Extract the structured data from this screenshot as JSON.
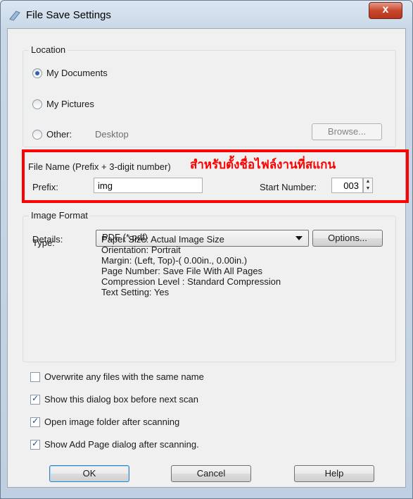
{
  "window": {
    "title": "File Save Settings",
    "close_label": "x"
  },
  "location": {
    "label": "Location",
    "options": [
      {
        "label": "My Documents",
        "checked": true
      },
      {
        "label": "My Pictures",
        "checked": false
      },
      {
        "label": "Other:",
        "checked": false
      }
    ],
    "other_path": "Desktop",
    "browse_label": "Browse..."
  },
  "file_name": {
    "label": "File Name (Prefix + 3-digit number)",
    "annotation": "สำหรับตั้งชื่อไฟล์งานที่สแกน",
    "prefix_label": "Prefix:",
    "prefix_value": "img",
    "start_label": "Start Number:",
    "start_value": "003"
  },
  "image_format": {
    "label": "Image Format",
    "type_label": "Type:",
    "type_value": "PDF (*.pdf)",
    "options_label": "Options...",
    "details_label": "Details:",
    "details": [
      "Paper Size: Actual Image Size",
      "Orientation: Portrait",
      "Margin: (Left, Top)-( 0.00in., 0.00in.)",
      "Page Number: Save File With All Pages",
      "Compression Level : Standard Compression",
      "Text Setting: Yes"
    ]
  },
  "checkboxes": [
    {
      "label": "Overwrite any files with the same name",
      "checked": false
    },
    {
      "label": "Show this dialog box before next scan",
      "checked": true
    },
    {
      "label": "Open image folder after scanning",
      "checked": true
    },
    {
      "label": "Show Add Page dialog after scanning.",
      "checked": true
    }
  ],
  "buttons": {
    "ok": "OK",
    "cancel": "Cancel",
    "help": "Help"
  },
  "colors": {
    "accent": "#ff0000"
  }
}
